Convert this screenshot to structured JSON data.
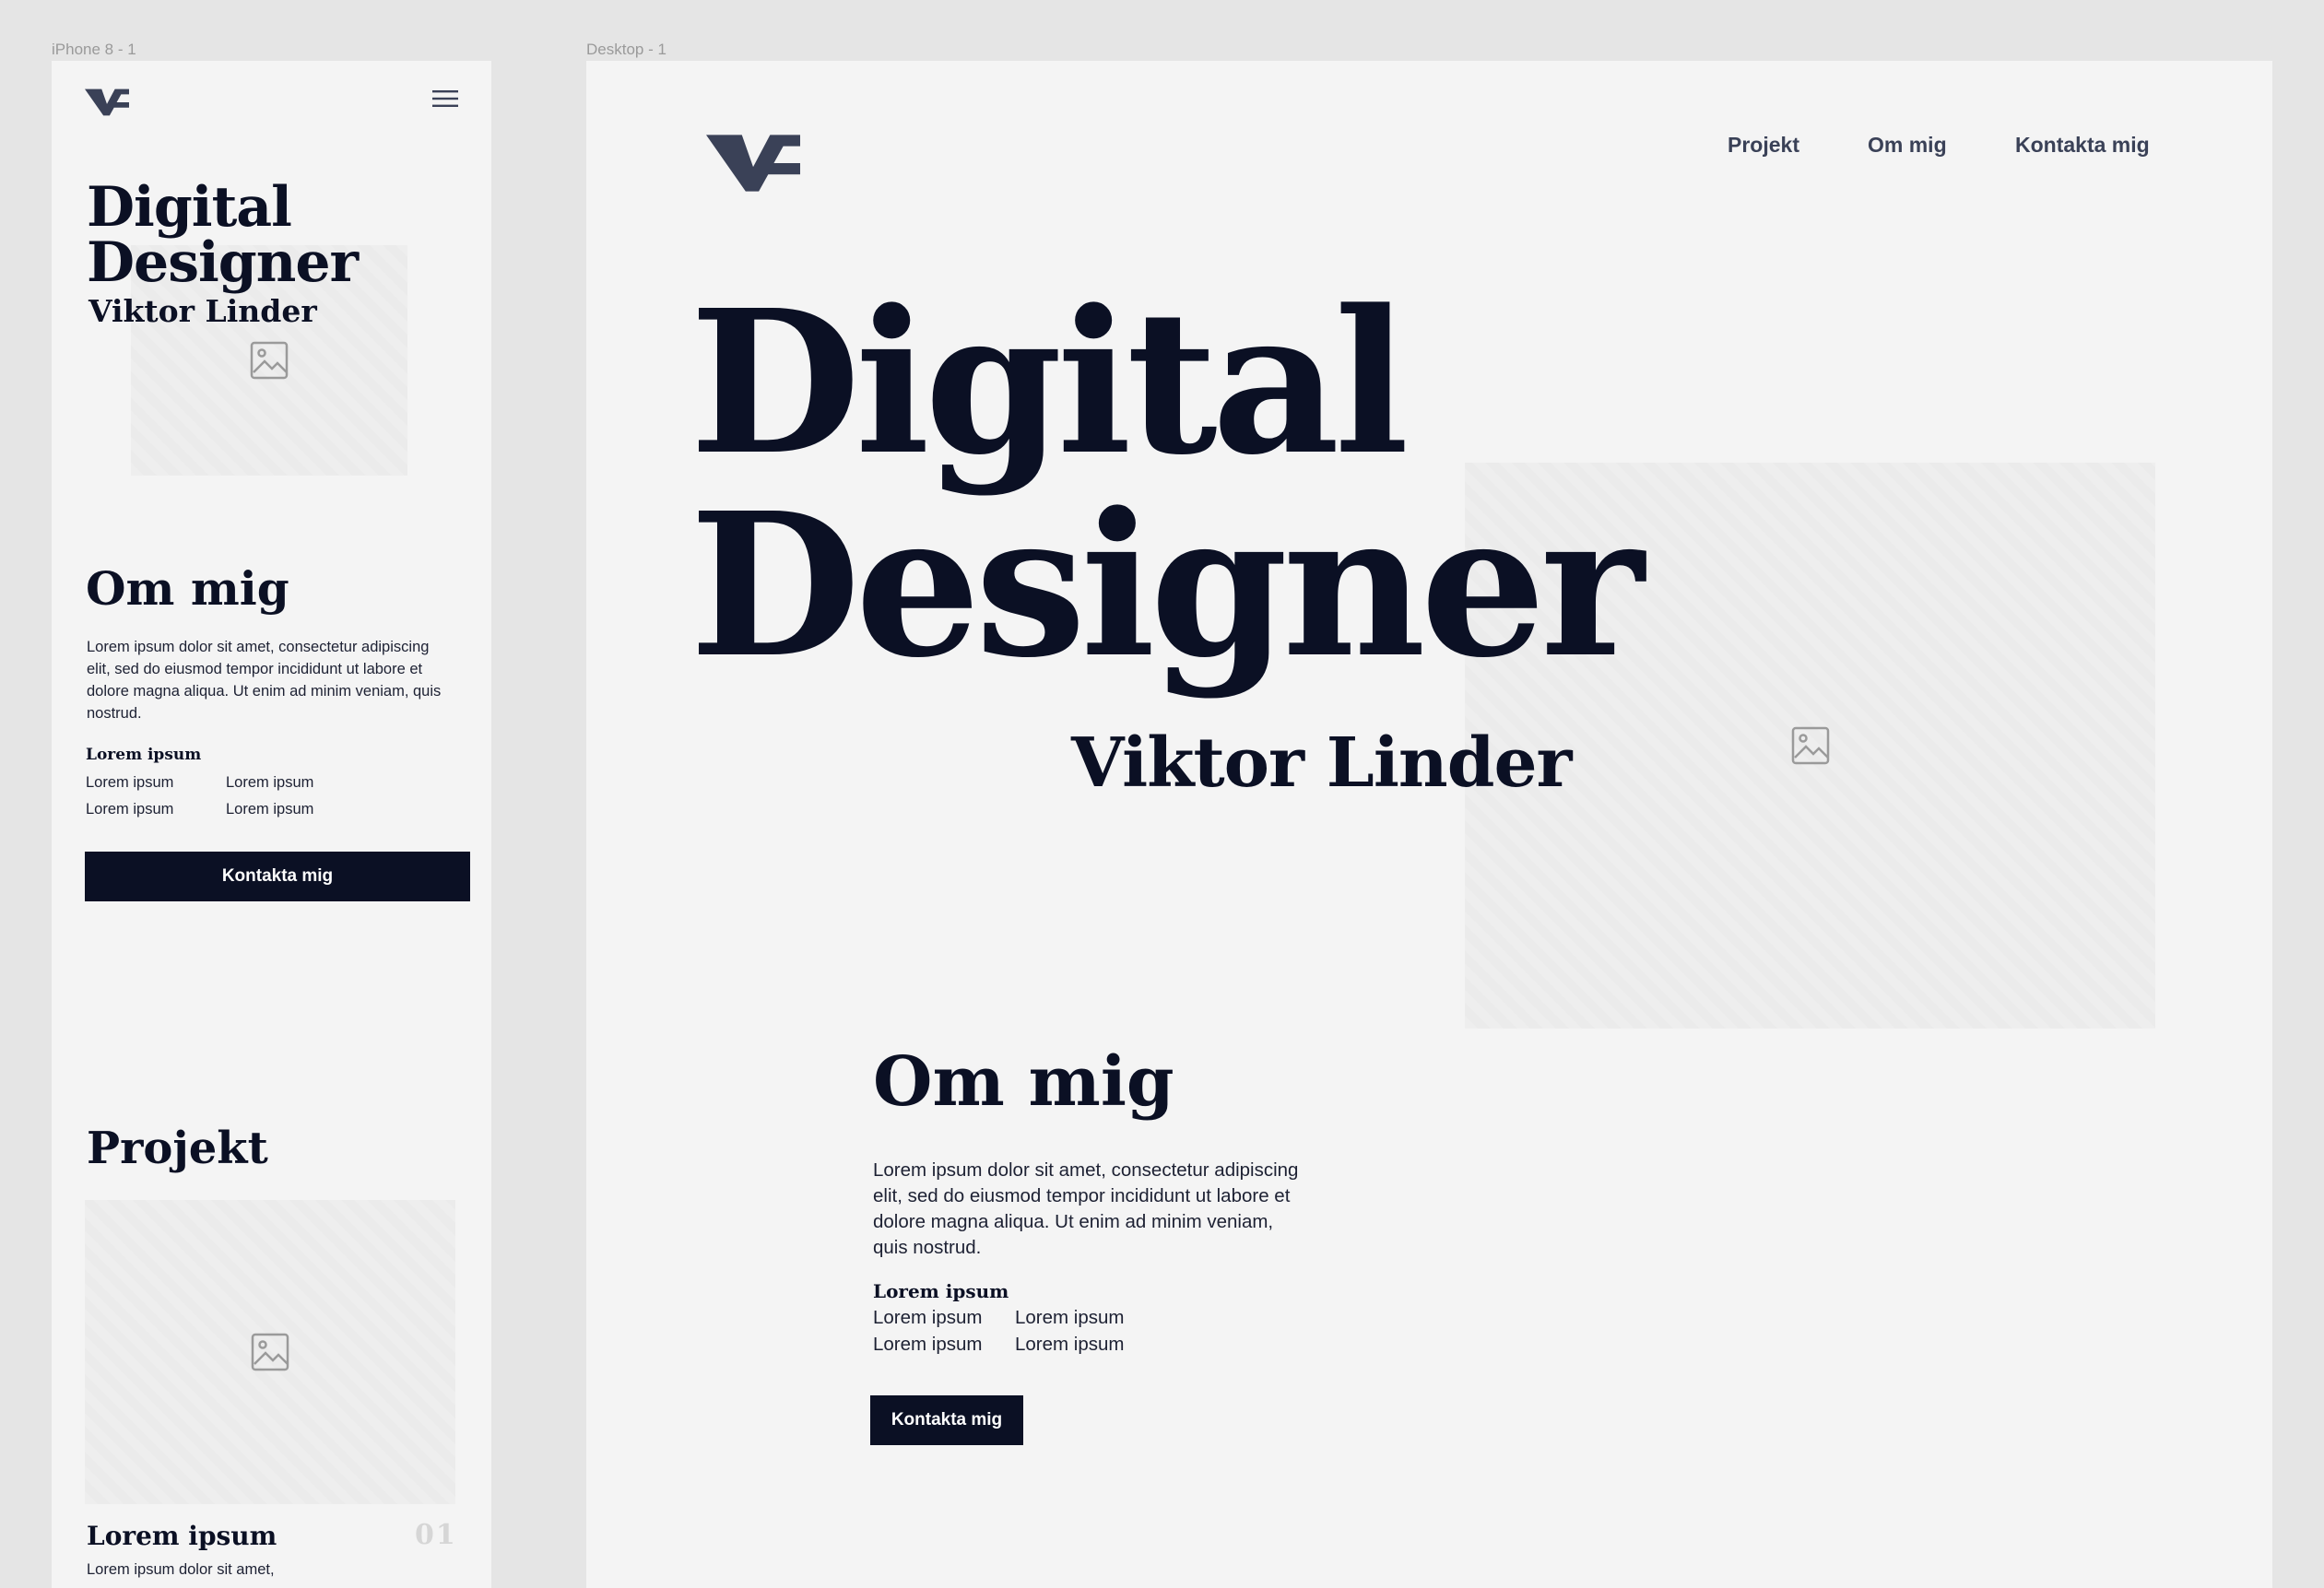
{
  "frames": {
    "mobile_label": "iPhone 8 - 1",
    "desktop_label": "Desktop - 1"
  },
  "colors": {
    "canvas": "#e5e5e5",
    "frame": "#f4f4f4",
    "ink": "#0b1024",
    "logo": "#3a4157"
  },
  "icons": {
    "logo": "logo-icon",
    "menu": "hamburger-menu-icon",
    "image_placeholder": "image-icon"
  },
  "mobile": {
    "hero": {
      "title_line1": "Digital",
      "title_line2": "Designer",
      "name": "Viktor Linder"
    },
    "about": {
      "heading": "Om mig",
      "paragraph_lines": [
        "Lorem ipsum dolor sit amet, consectetur adipiscing",
        "elit, sed do eiusmod tempor incididunt ut labore et",
        "dolore magna aliqua. Ut enim ad minim veniam, quis",
        "nostrud."
      ],
      "list_heading": "Lorem ipsum",
      "list_items": [
        "Lorem ipsum",
        "Lorem ipsum",
        "Lorem ipsum",
        "Lorem ipsum"
      ],
      "cta_label": "Kontakta mig"
    },
    "projects": {
      "heading": "Projekt",
      "card_title": "Lorem ipsum",
      "card_number": "01",
      "card_text": "Lorem ipsum dolor sit amet,"
    }
  },
  "desktop": {
    "nav": [
      "Projekt",
      "Om mig",
      "Kontakta mig"
    ],
    "hero": {
      "title_line1": "Digital",
      "title_line2": "Designer",
      "name": "Viktor Linder"
    },
    "about": {
      "heading": "Om mig",
      "paragraph_lines": [
        "Lorem ipsum dolor sit amet, consectetur adipiscing",
        "elit, sed do eiusmod tempor incididunt ut labore et",
        "dolore magna aliqua. Ut enim ad minim veniam,",
        "quis nostrud."
      ],
      "list_heading": "Lorem ipsum",
      "list_items": [
        "Lorem ipsum",
        "Lorem ipsum",
        "Lorem ipsum",
        "Lorem ipsum"
      ],
      "cta_label": "Kontakta mig"
    }
  }
}
